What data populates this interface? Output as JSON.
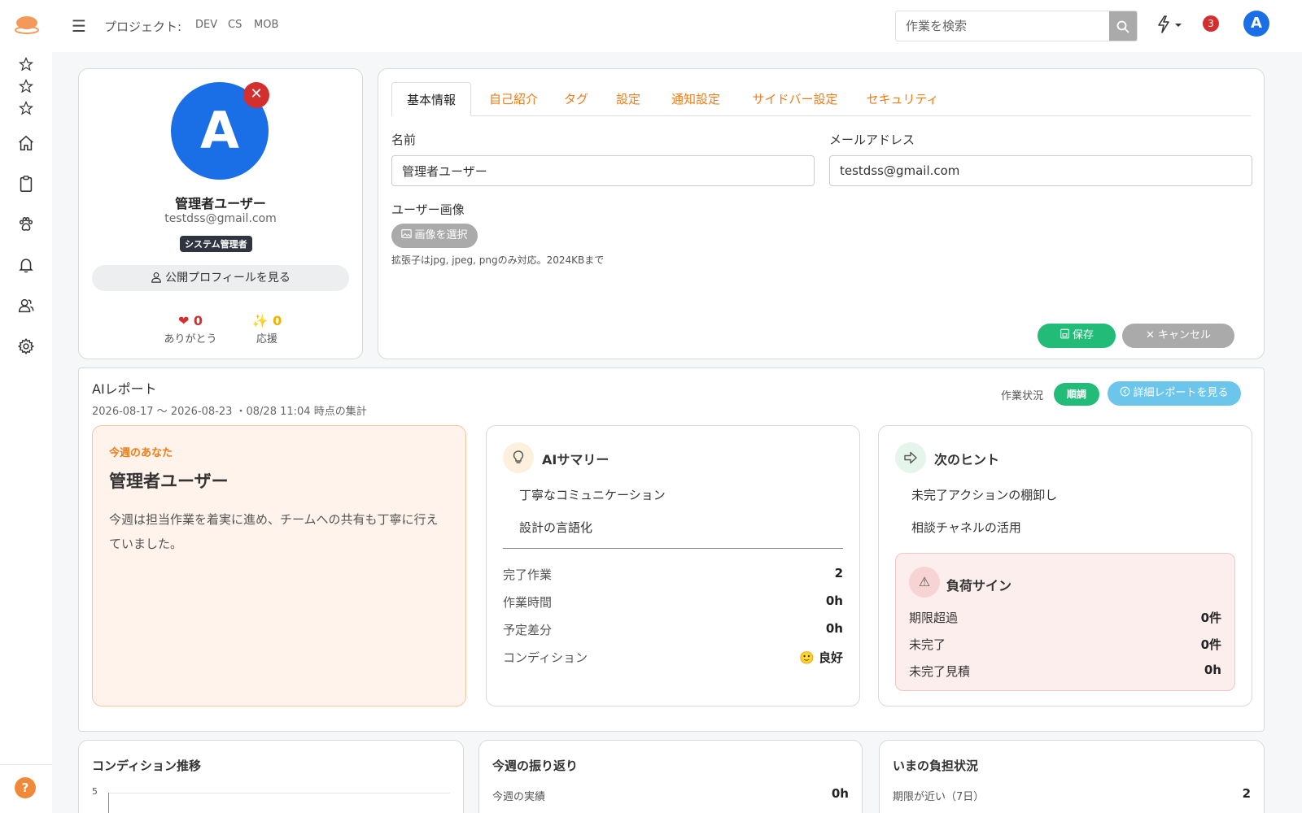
{
  "topbar": {
    "project_label": "プロジェクト:",
    "projects": [
      "DEV",
      "CS",
      "MOB"
    ],
    "search_placeholder": "作業を検索",
    "notification_count": "3",
    "user_initial": "A"
  },
  "colors": {
    "accent": "#f07c18",
    "primary": "#1b6fe6",
    "success": "#22bb77",
    "danger": "#d32f2f",
    "info": "#6cc6ec"
  },
  "sidebar": {
    "icons": [
      "star-icon",
      "star-icon",
      "star-icon",
      "home-icon",
      "clipboard-icon",
      "paw-icon",
      "bell-icon",
      "users-icon",
      "gear-icon"
    ],
    "help_label": "?"
  },
  "profile": {
    "initial": "A",
    "name": "管理者ユーザー",
    "email": "testdss@gmail.com",
    "role": "システム管理者",
    "public_profile_label": "公開プロフィールを見る",
    "thanks_count": "❤ 0",
    "thanks_label": "ありがとう",
    "cheer_count": "✨ 0",
    "cheer_label": "応援"
  },
  "settings": {
    "tabs": [
      "基本情報",
      "自己紹介",
      "タグ",
      "設定",
      "通知設定",
      "サイドバー設定",
      "セキュリティ"
    ],
    "name_label": "名前",
    "name_value": "管理者ユーザー",
    "email_label": "メールアドレス",
    "email_value": "testdss@gmail.com",
    "image_label": "ユーザー画像",
    "image_button": "画像を選択",
    "image_hint": "拡張子はjpg, jpeg, pngのみ対応。2024KBまで",
    "save_label": "保存",
    "cancel_label": "キャンセル"
  },
  "ai_report": {
    "title": "AIレポート",
    "range": "2026-08-17 〜 2026-08-23 ・08/28 11:04 時点の集計",
    "status_label": "作業状況",
    "status_value": "順調",
    "detail_button": "詳細レポートを見る",
    "you": {
      "kicker": "今週のあなた",
      "name": "管理者ユーザー",
      "text": "今週は担当作業を着実に進め、チームへの共有も丁寧に行えていました。"
    },
    "summary": {
      "title": "AIサマリー",
      "bullets": [
        "丁寧なコミュニケーション",
        "設計の言語化"
      ],
      "metrics": [
        {
          "label": "完了作業",
          "value": "2"
        },
        {
          "label": "作業時間",
          "value": "0h"
        },
        {
          "label": "予定差分",
          "value": "0h"
        },
        {
          "label": "コンディション",
          "value": "🙂 良好"
        }
      ]
    },
    "hint": {
      "title": "次のヒント",
      "bullets": [
        "未完了アクションの棚卸し",
        "相談チャネルの活用"
      ],
      "load_title": "負荷サイン",
      "load_rows": [
        {
          "label": "期限超過",
          "value": "0件"
        },
        {
          "label": "未完了",
          "value": "0件"
        },
        {
          "label": "未完了見積",
          "value": "0h"
        }
      ]
    }
  },
  "bottom": {
    "condition_title": "コンディション推移",
    "condition_axis_top": "5",
    "review_title": "今週の振り返り",
    "review_row_label": "今週の実績",
    "review_row_value": "0h",
    "load_title": "いまの負担状況",
    "load_row_label": "期限が近い（7日）",
    "load_row_value": "2"
  }
}
